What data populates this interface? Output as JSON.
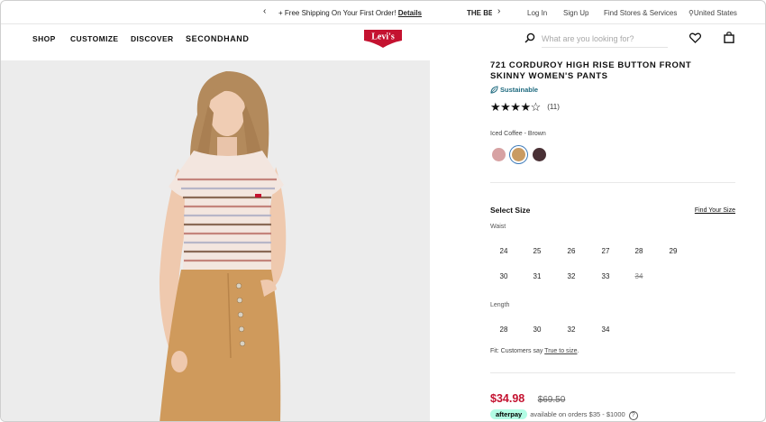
{
  "promo": {
    "message": "+ Free Shipping On Your First Order!",
    "message_link": "Details",
    "next_message": "THE BE",
    "utility": {
      "login": "Log In",
      "signup": "Sign Up",
      "stores": "Find Stores & Services",
      "country": "United States"
    }
  },
  "header": {
    "nav": [
      "SHOP",
      "CUSTOMIZE",
      "DISCOVER",
      "SECONDHAND"
    ],
    "logo_text": "Levi's",
    "search_placeholder": "What are you looking for?"
  },
  "product": {
    "title": "721 CORDUROY HIGH RISE BUTTON FRONT SKINNY WOMEN'S PANTS",
    "sustainable_label": "Sustainable",
    "stars": "★★★★☆",
    "rating_value": 4.5,
    "review_count": "(11)",
    "color_name": "Iced Coffee - Brown",
    "swatches": [
      "#d7a2a3",
      "#c99b63",
      "#4a3136"
    ],
    "select_size": "Select Size",
    "find_your_size": "Find Your Size",
    "waist_label": "Waist",
    "waist_sizes": [
      "24",
      "25",
      "26",
      "27",
      "28",
      "29",
      "30",
      "31",
      "32",
      "33",
      "34"
    ],
    "length_label": "Length",
    "length_sizes": [
      "28",
      "30",
      "32",
      "34"
    ],
    "fit_prefix": "Fit: Customers say ",
    "fit_link": "True to size",
    "fit_suffix": ".",
    "price": "$34.98",
    "original_price": "$69.50",
    "afterpay_badge": "afterpay",
    "afterpay_text": "available on orders $35 - $1000"
  },
  "colors": {
    "sale_red": "#c41230",
    "levis_red": "#c41230",
    "afterpay_mint": "#b2fce4",
    "sustain_teal": "#1e6a7f"
  }
}
